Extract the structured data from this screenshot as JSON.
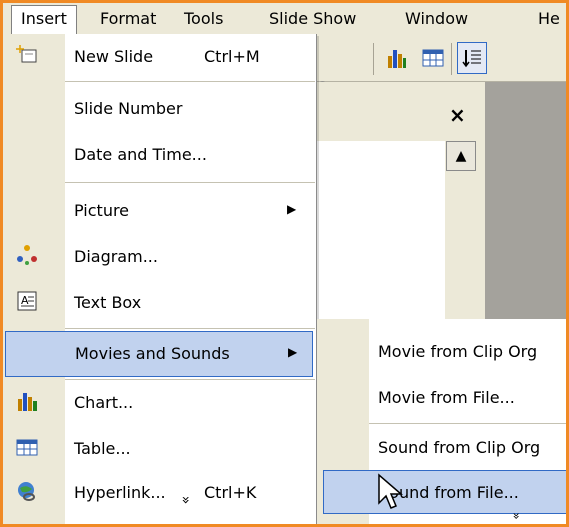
{
  "menubar": {
    "items": [
      {
        "label": "Insert"
      },
      {
        "label": "Format"
      },
      {
        "label": "Tools"
      },
      {
        "label": "Slide Show"
      },
      {
        "label": "Window"
      },
      {
        "label": "He"
      }
    ]
  },
  "insert_menu": {
    "items": [
      {
        "label": "New Slide",
        "shortcut": "Ctrl+M",
        "icon": "new-slide-icon"
      },
      {
        "label": "Slide Number"
      },
      {
        "label": "Date and Time..."
      },
      {
        "label": "Picture",
        "submenu": true
      },
      {
        "label": "Diagram...",
        "icon": "diagram-icon"
      },
      {
        "label": "Text Box",
        "icon": "text-box-icon"
      },
      {
        "label": "Movies and Sounds",
        "submenu": true,
        "highlighted": true
      },
      {
        "label": "Chart...",
        "icon": "chart-icon"
      },
      {
        "label": "Table...",
        "icon": "table-icon"
      },
      {
        "label": "Hyperlink...",
        "shortcut": "Ctrl+K",
        "icon": "hyperlink-icon"
      }
    ],
    "more_glyph": "»"
  },
  "movies_sounds_menu": {
    "items": [
      {
        "label": "Movie from Clip Org"
      },
      {
        "label": "Movie from File..."
      },
      {
        "label": "Sound from Clip Org"
      },
      {
        "label": "Sound from File...",
        "highlighted": true
      }
    ],
    "more_glyph": "»"
  },
  "pane": {
    "close_glyph": "×",
    "scroll_up_glyph": "▲"
  },
  "colors": {
    "highlight": "#c1d2ee",
    "highlight_border": "#316ac5",
    "menu_strip": "#ece9d8",
    "frame": "#f08a24"
  }
}
